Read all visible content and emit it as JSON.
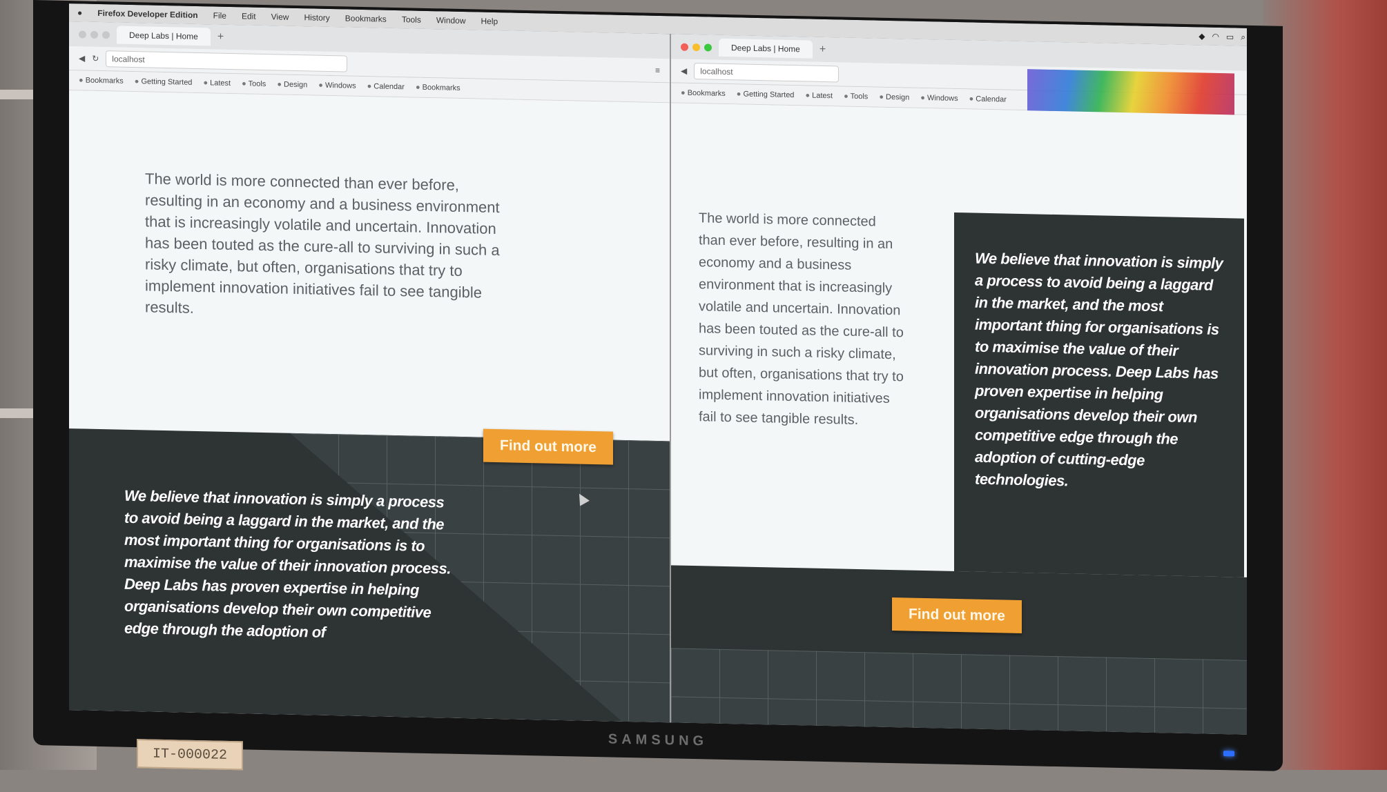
{
  "monitor": {
    "brand": "SAMSUNG",
    "asset_tag": "IT-000022"
  },
  "menubar": {
    "app_name": "Firefox Developer Edition",
    "items": [
      "File",
      "Edit",
      "View",
      "History",
      "Bookmarks",
      "Tools",
      "Window",
      "Help"
    ]
  },
  "left_window": {
    "tab_title": "Deep Labs | Home",
    "url": "localhost",
    "bookmarks": [
      "Bookmarks",
      "Getting Started",
      "Latest",
      "Tools",
      "Design",
      "Windows",
      "Calendar",
      "Bookmarks"
    ],
    "intro_text": "The world is more connected than ever before, resulting in an economy and a business environment that is increasingly volatile and uncertain. Innovation has been touted as the cure-all to surviving in such a risky climate, but often, organisations that try to implement innovation initiatives fail to see tangible results.",
    "belief_text": "We believe that innovation is simply a process to avoid being a laggard in the market, and the most important thing for organisations is to maximise the value of their innovation process. Deep Labs has proven expertise in helping organisations develop their own competitive edge through the adoption of",
    "cta_label": "Find out more"
  },
  "right_window": {
    "tab_title": "Deep Labs | Home",
    "url": "localhost",
    "bookmarks": [
      "Bookmarks",
      "Getting Started",
      "Latest",
      "Tools",
      "Design",
      "Windows",
      "Calendar"
    ],
    "intro_text": "The world is more connected than ever before, resulting in an economy and a business environment that is increasingly volatile and uncertain. Innovation has been touted as the cure-all to surviving in such a risky climate, but often, organisations that try to implement innovation initiatives fail to see tangible results.",
    "belief_text": "We believe that innovation is simply a process to avoid being a laggard in the market, and the most important thing for organisations is to maximise the value of their innovation process. Deep Labs has proven expertise in helping organisations develop their own competitive edge through the adoption of cutting-edge technologies.",
    "cta_label": "Find out more"
  },
  "colors": {
    "accent_orange": "#f0a032",
    "dark_band": "#2e3334",
    "page_bg": "#f4f7f8"
  }
}
